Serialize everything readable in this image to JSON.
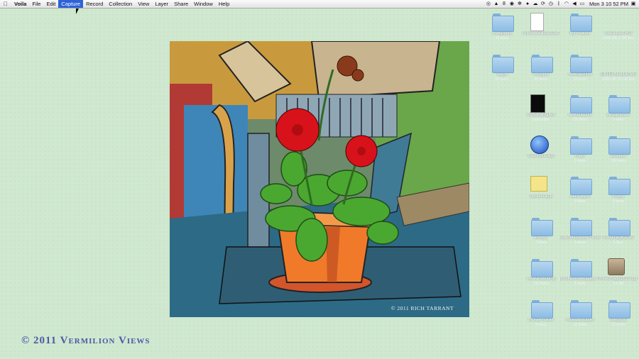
{
  "menubar": {
    "apple_icon": "apple-icon",
    "items": [
      "Voila",
      "File",
      "Edit",
      "Capture",
      "Record",
      "Collection",
      "View",
      "Layer",
      "Share",
      "Window",
      "Help"
    ],
    "active_item": "Capture",
    "status_icons": [
      "capture-icon",
      "adobe-icon",
      "8-badge",
      "eye-icon",
      "gear-icon",
      "paw-icon",
      "cloud-icon",
      "sync-icon",
      "timemachine-icon",
      "bluetooth-icon",
      "wifi-icon",
      "volume-icon",
      "battery-icon",
      "display-icon"
    ],
    "status_badge": "8",
    "clock": "Mon 3 10 52 PM"
  },
  "painting": {
    "credit": "© 2011 RICH TARRANT",
    "colors": {
      "flower": "#d8121a",
      "pot": "#f07a2a",
      "leaves": "#4aa830",
      "bench": "#2a5f8a",
      "background": "#c99a3d"
    }
  },
  "watermark": "© 2011 Vermilion Views",
  "desktop": {
    "icons": [
      {
        "label": "weeghtery",
        "sub": "39 items",
        "kind": "folder"
      },
      {
        "label": "referencelibrars.pdf",
        "sub": "",
        "kind": "doc"
      },
      {
        "label": "My Images",
        "sub": "",
        "kind": "folder"
      },
      {
        "label": "Macintosh HD",
        "sub": "1000 GB, 3 GB free",
        "kind": "drive"
      },
      {
        "label": "Vagrk",
        "sub": "39 items",
        "kind": "folder"
      },
      {
        "label": "Pictopia",
        "sub": "59 items",
        "kind": "folder"
      },
      {
        "label": "newdataflow",
        "sub": "19 items",
        "kind": "folder"
      },
      {
        "label": "EXTERNALDRIVE",
        "sub": "1000 GB, 97 GB free",
        "kind": "usb"
      },
      {
        "label": "richtarrantallen",
        "sub": "Uprpanthe",
        "kind": "portrait"
      },
      {
        "label": "newdiffeshm",
        "sub": "195 items",
        "kind": "folder"
      },
      {
        "label": "designfolder",
        "sub": "6 items",
        "kind": "folder"
      },
      {
        "label": "Seashore.app",
        "sub": "",
        "kind": "app-blue"
      },
      {
        "label": "Hello",
        "sub": "3 items",
        "kind": "folder"
      },
      {
        "label": "Eksaver",
        "sub": "199 items",
        "kind": "folder"
      },
      {
        "label": "Stickies.app",
        "sub": "",
        "kind": "notes"
      },
      {
        "label": "oldimages",
        "sub": "8 items",
        "kind": "folder"
      },
      {
        "label": "Frayle",
        "sub": "0 items",
        "kind": "folder"
      },
      {
        "label": "voxaytr",
        "sub": "7 items",
        "kind": "folder"
      },
      {
        "label": "olderwebpages Folder",
        "sub": "5 items",
        "kind": "folder"
      },
      {
        "label": "freeomagic2010",
        "sub": "1 item",
        "kind": "folder"
      },
      {
        "label": "viewsinbuilding",
        "sub": "233 items",
        "kind": "folder"
      },
      {
        "label": "precedentwebpages Folder",
        "sub": "6 items",
        "kind": "folder"
      },
      {
        "label": "freeomagic2010.zip",
        "sub": "24 MB",
        "kind": "pkg"
      },
      {
        "label": "mckay Folder",
        "sub": "8 items",
        "kind": "folder"
      },
      {
        "label": "redalbumbuyin",
        "sub": "16 items",
        "kind": "folder"
      },
      {
        "label": "thingsdb",
        "sub": "31 items",
        "kind": "folder"
      }
    ]
  }
}
